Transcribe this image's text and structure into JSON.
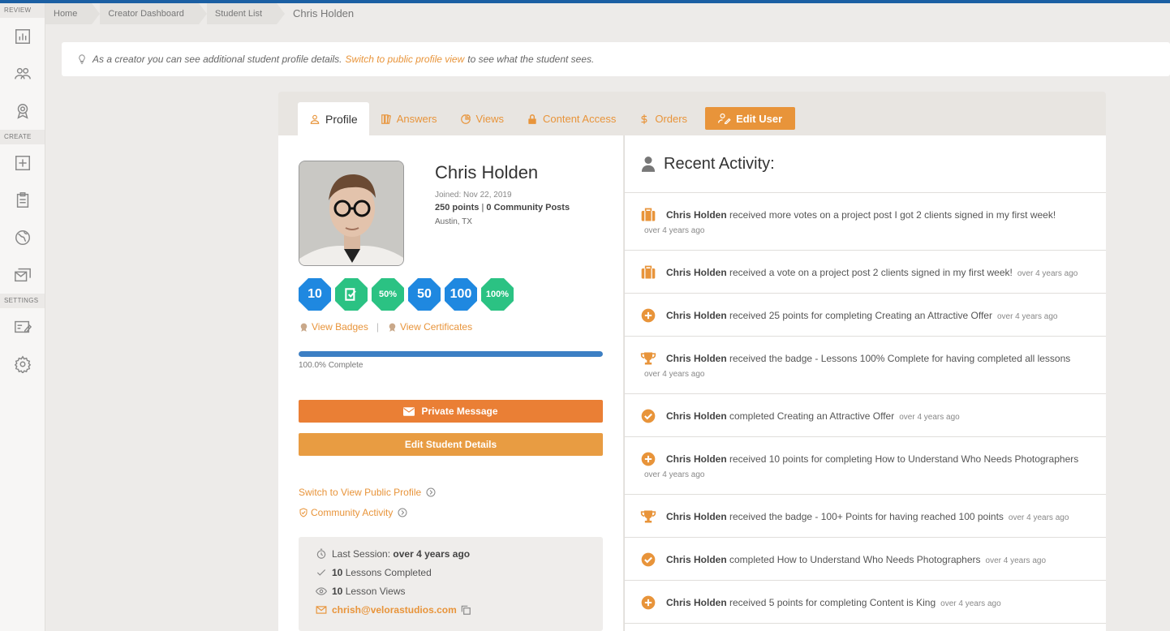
{
  "sidebar": {
    "sections": {
      "review": "REVIEW",
      "create": "CREATE",
      "settings": "SETTINGS"
    }
  },
  "breadcrumbs": [
    "Home",
    "Creator Dashboard",
    "Student List",
    "Chris Holden"
  ],
  "notice": {
    "before": "As a creator you can see additional student profile details.",
    "link": "Switch to public profile view",
    "after": "to see what the student sees."
  },
  "tabs": [
    "Profile",
    "Answers",
    "Views",
    "Content Access",
    "Orders"
  ],
  "edit_user_label": "Edit User",
  "profile": {
    "name": "Chris Holden",
    "joined": "Joined: Nov 22, 2019",
    "points": "250 points",
    "posts": "0 Community Posts",
    "location": "Austin, TX",
    "badges": [
      "10",
      "",
      "50%",
      "50",
      "100",
      "100%"
    ],
    "view_badges": "View Badges",
    "view_certificates": "View Certificates",
    "progress": 1.0,
    "progress_label": "100.0% Complete",
    "private_message": "Private Message",
    "edit_student": "Edit Student Details",
    "switch_public": "Switch to View Public Profile",
    "community_activity": "Community Activity"
  },
  "stats": {
    "last_session_label": "Last Session:",
    "last_session_value": "over 4 years ago",
    "lessons_completed_num": "10",
    "lessons_completed_label": "Lessons Completed",
    "lesson_views_num": "10",
    "lesson_views_label": "Lesson Views",
    "email": "chrish@velorastudios.com"
  },
  "recent_activity": {
    "title": "Recent Activity:",
    "items": [
      {
        "icon": "briefcase-icon",
        "name": "Chris Holden",
        "text": "received more votes on a project post I got 2 clients signed in my first week!",
        "ago": "over 4 years ago"
      },
      {
        "icon": "briefcase-icon",
        "name": "Chris Holden",
        "text": "received a vote on a project post 2 clients signed in my first week!",
        "ago": "over 4 years ago"
      },
      {
        "icon": "plus-circle-icon",
        "name": "Chris Holden",
        "text": "received 25 points for completing Creating an Attractive Offer",
        "ago": "over 4 years ago"
      },
      {
        "icon": "trophy-icon",
        "name": "Chris Holden",
        "text": "received the badge - Lessons 100% Complete for having completed all lessons",
        "ago": "over 4 years ago"
      },
      {
        "icon": "check-circle-icon",
        "name": "Chris Holden",
        "text": "completed Creating an Attractive Offer",
        "ago": "over 4 years ago"
      },
      {
        "icon": "plus-circle-icon",
        "name": "Chris Holden",
        "text": "received 10 points for completing How to Understand Who Needs Photographers",
        "ago": "over 4 years ago"
      },
      {
        "icon": "trophy-icon",
        "name": "Chris Holden",
        "text": "received the badge - 100+ Points for having reached 100 points",
        "ago": "over 4 years ago"
      },
      {
        "icon": "check-circle-icon",
        "name": "Chris Holden",
        "text": "completed How to Understand Who Needs Photographers",
        "ago": "over 4 years ago"
      },
      {
        "icon": "plus-circle-icon",
        "name": "Chris Holden",
        "text": "received 5 points for completing Content is King",
        "ago": "over 4 years ago"
      }
    ]
  }
}
